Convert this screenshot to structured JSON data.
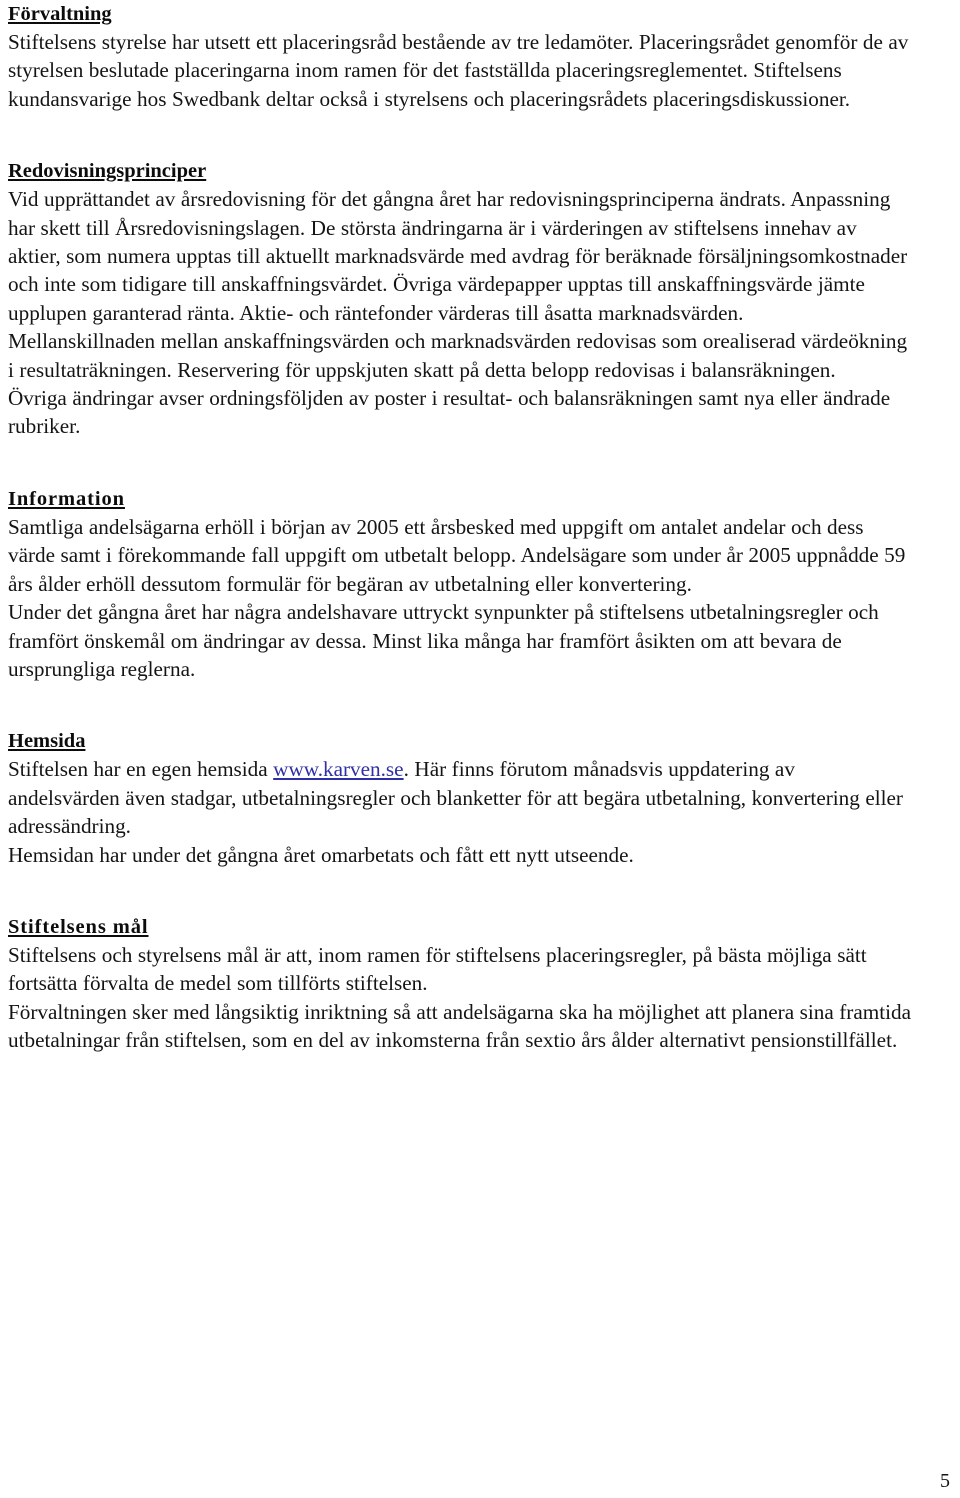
{
  "document": {
    "page_number": "5",
    "language": "sv",
    "link_color": "#2f2fa6",
    "text_color": "#141414"
  },
  "sections": [
    {
      "id": "forvaltning",
      "heading": "Förvaltning",
      "paragraphs": [
        "Stiftelsens styrelse har utsett ett placeringsråd bestående av tre ledamöter. Placeringsrådet genomför de av styrelsen beslutade placeringarna inom ramen för det fastställda placeringsreglementet. Stiftelsens kundansvarige hos Swedbank deltar också i styrelsens och placeringsrådets placeringsdiskussioner."
      ]
    },
    {
      "id": "redovisningsprinciper",
      "heading": "Redovisningsprinciper",
      "paragraphs": [
        "Vid upprättandet av årsredovisning för det gångna året har redovisningsprinciperna ändrats. Anpassning har skett till Årsredovisningslagen. De största ändringarna är i värderingen av stiftelsens innehav av aktier, som numera upptas till aktuellt marknadsvärde med avdrag för beräknade försäljningsomkostnader och inte som tidigare till anskaffningsvärdet. Övriga värdepapper upptas till anskaffningsvärde jämte upplupen garanterad ränta. Aktie- och räntefonder värderas till åsatta marknadsvärden.",
        "Mellanskillnaden mellan anskaffningsvärden och marknadsvärden redovisas som orealiserad värdeökning i resultaträkningen. Reservering för uppskjuten skatt på detta belopp redovisas i balansräkningen.",
        "Övriga ändringar avser ordningsföljden av poster i resultat- och balansräkningen samt nya eller ändrade rubriker."
      ]
    },
    {
      "id": "information",
      "heading": "Information",
      "paragraphs": [
        "Samtliga andelsägarna erhöll i början av 2005 ett årsbesked med uppgift om antalet andelar och dess värde samt i förekommande fall uppgift om utbetalt belopp. Andelsägare som under år 2005 uppnådde 59 års ålder erhöll dessutom formulär för begäran av utbetalning eller konvertering.",
        "Under det gångna året har några andelshavare uttryckt synpunkter på stiftelsens utbetalningsregler och framfört önskemål om ändringar av dessa. Minst lika många har framfört åsikten om att bevara de ursprungliga reglerna."
      ]
    },
    {
      "id": "hemsida",
      "heading": "Hemsida",
      "paragraphs": [
        {
          "before_link": "Stiftelsen har en egen hemsida ",
          "link_text": "www.karven.se",
          "after_link": ". Här finns förutom månadsvis uppdatering av andelsvärden även stadgar, utbetalningsregler och blanketter för att begära utbetalning, konvertering eller adressändring."
        },
        "Hemsidan har under det gångna året omarbetats och fått ett nytt utseende."
      ]
    },
    {
      "id": "stiftelsens-mal",
      "heading": "Stiftelsens mål",
      "paragraphs": [
        "Stiftelsens och styrelsens mål är att, inom ramen för stiftelsens placeringsregler, på bästa möjliga sätt fortsätta förvalta de medel som tillförts stiftelsen.",
        "Förvaltningen sker med långsiktig inriktning så att andelsägarna ska ha möjlighet att planera sina framtida utbetalningar från stiftelsen, som en del av inkomsterna från sextio års ålder alternativt pensionstillfället."
      ]
    }
  ]
}
